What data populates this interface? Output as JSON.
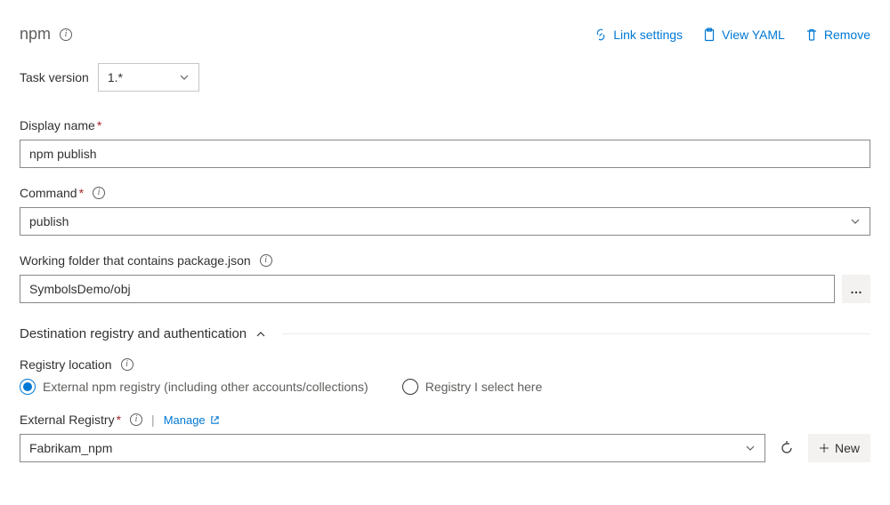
{
  "header": {
    "title": "npm",
    "actions": {
      "link_settings": "Link settings",
      "view_yaml": "View YAML",
      "remove": "Remove"
    }
  },
  "task_version": {
    "label": "Task version",
    "value": "1.*"
  },
  "fields": {
    "display_name": {
      "label": "Display name",
      "value": "npm publish"
    },
    "command": {
      "label": "Command",
      "value": "publish"
    },
    "working_folder": {
      "label": "Working folder that contains package.json",
      "value": "SymbolsDemo/obj"
    }
  },
  "section": {
    "title": "Destination registry and authentication"
  },
  "registry_location": {
    "label": "Registry location",
    "options": {
      "external": "External npm registry (including other accounts/collections)",
      "select_here": "Registry I select here"
    },
    "selected": "external"
  },
  "external_registry": {
    "label": "External Registry",
    "manage": "Manage",
    "value": "Fabrikam_npm",
    "new_btn": "New"
  }
}
